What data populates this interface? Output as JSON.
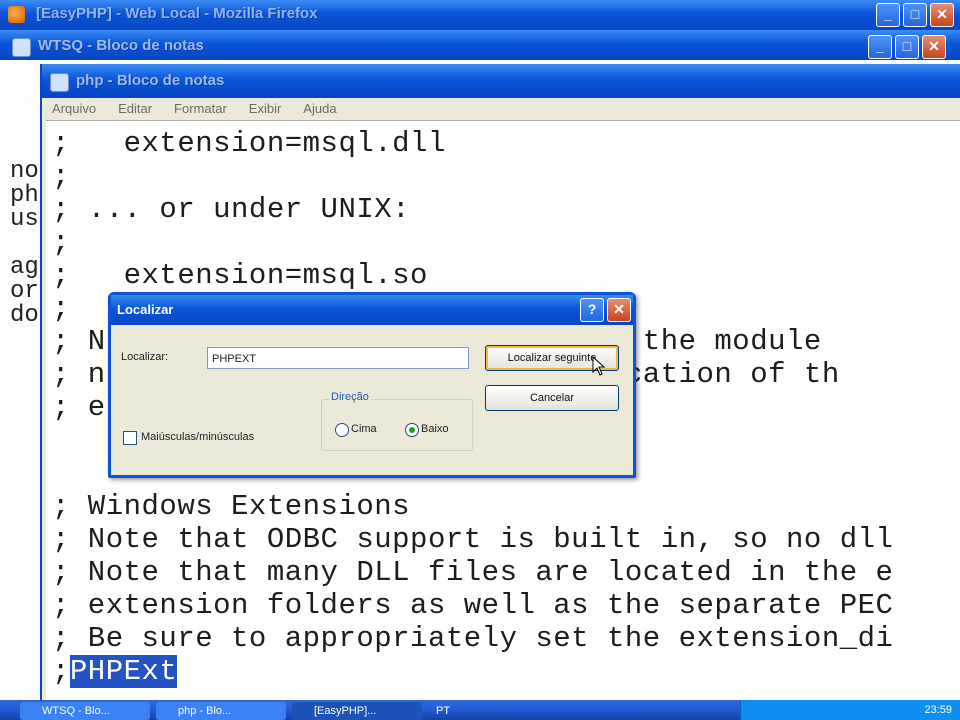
{
  "firefox_title": "[EasyPHP] - Web Local - Mozilla Firefox",
  "wtsq_title": "WTSQ - Bloco de notas",
  "php_title": "php - Bloco de notas",
  "menu": [
    "Arquivo",
    "Editar",
    "Formatar",
    "Exibir",
    "Ajuda"
  ],
  "bg_lines": [
    "no",
    "ph",
    "us",
    "",
    "ag",
    "or",
    "do"
  ],
  "editor_lines": [
    ";   extension=msql.dll",
    ";",
    "; ... or under UNIX:",
    ";",
    ";   extension=msql.so",
    ";",
    "; N                       ame of the module",
    "; n                        he location of th",
    "; e                         e.",
    "",
    "",
    "; Windows Extensions",
    "; Note that ODBC support is built in, so no dll",
    "; Note that many DLL files are located in the e",
    "; extension folders as well as the separate PEC",
    "; Be sure to appropriately set the extension_di"
  ],
  "last_line": {
    "prefix": ";",
    "selected": "PHPExt"
  },
  "find_dialog": {
    "title": "Localizar",
    "label": "Localizar:",
    "value": "PHPEXT",
    "find_next": "Localizar seguinte",
    "cancel": "Cancelar",
    "match_case": "Maiúsculas/minúsculas",
    "direction_label": "Direção",
    "up": "Cima",
    "down": "Baixo",
    "direction_selected": "down"
  },
  "taskbar": {
    "items": [
      "WTSQ - Blo...",
      "php - Blo...",
      "[EasyPHP]...",
      "PT"
    ],
    "clock": "23:59"
  },
  "colors": {
    "xp_blue": "#0a55d8",
    "selection": "#2453c5"
  }
}
